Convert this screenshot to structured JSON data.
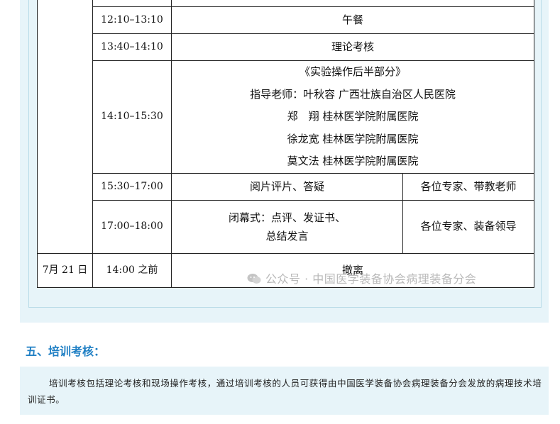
{
  "schedule": {
    "rows": [
      {
        "time": "12:10–13:10",
        "content": "午餐"
      },
      {
        "time": "13:40–14:10",
        "content": "理论考核"
      },
      {
        "time": "14:10–15:30",
        "lines": [
          "《实验操作后半部分》",
          "指导老师：叶秋容 广西壮族自治区人民医院",
          "郑　翔 桂林医学院附属医院",
          "徐龙宽 桂林医学院附属医院",
          "莫文法 桂林医学院附属医院"
        ]
      },
      {
        "time": "15:30–17:00",
        "content": "阅片评片、答疑",
        "person": "各位专家、带教老师"
      },
      {
        "time": "17:00–18:00",
        "lines": [
          "闭幕式：点评、发证书、",
          "总结发言"
        ],
        "person": "各位专家、装备领导"
      },
      {
        "date": "7月 21 日",
        "time": "14:00 之前",
        "content": "撤离"
      }
    ]
  },
  "watermark": "公众号 · 中国医学装备协会病理装备分会",
  "section": {
    "title": "五、培训考核：",
    "body": "培训考核包括理论考核和现场操作考核，通过培训考核的人员可获得由中国医学装备协会病理装备分会发放的病理技术培训证书。"
  }
}
